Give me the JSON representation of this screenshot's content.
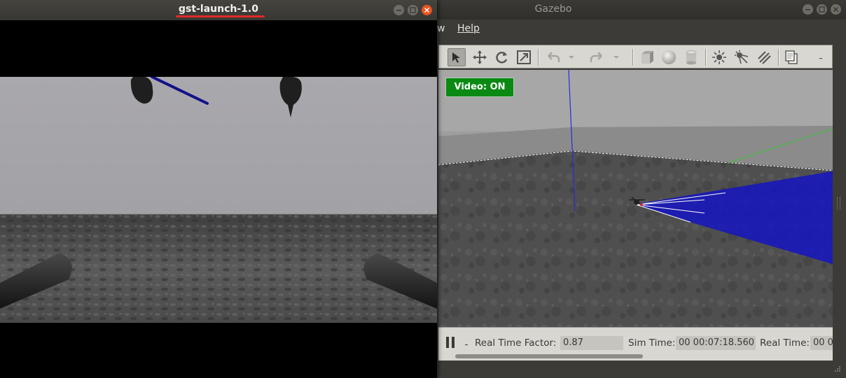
{
  "gazebo": {
    "title": "Gazebo",
    "menu": {
      "view_partial": "w",
      "help": "Help"
    },
    "toolbar": {
      "tools": [
        "select-icon",
        "translate-icon",
        "rotate-icon",
        "scale-icon",
        "undo-icon",
        "undo-dropdown-icon",
        "redo-icon",
        "redo-dropdown-icon",
        "box-icon",
        "sphere-icon",
        "cylinder-icon",
        "point-light-icon",
        "spot-light-icon",
        "directional-light-icon",
        "copy-icon"
      ]
    },
    "viewport": {
      "video_badge": "Video: ON"
    },
    "statusbar": {
      "real_time_factor_label": "Real Time Factor:",
      "real_time_factor_value": "0.87",
      "sim_time_label": "Sim Time:",
      "sim_time_value": "00 00:07:18.560",
      "real_time_label": "Real Time:",
      "real_time_value": "00 0"
    }
  },
  "gst": {
    "title": "gst-launch-1.0"
  },
  "colors": {
    "ubuntu_orange": "#e95420",
    "video_on_green": "#0a8a12",
    "title_underline": "#e02828",
    "laser_blue": "#1010c8"
  }
}
